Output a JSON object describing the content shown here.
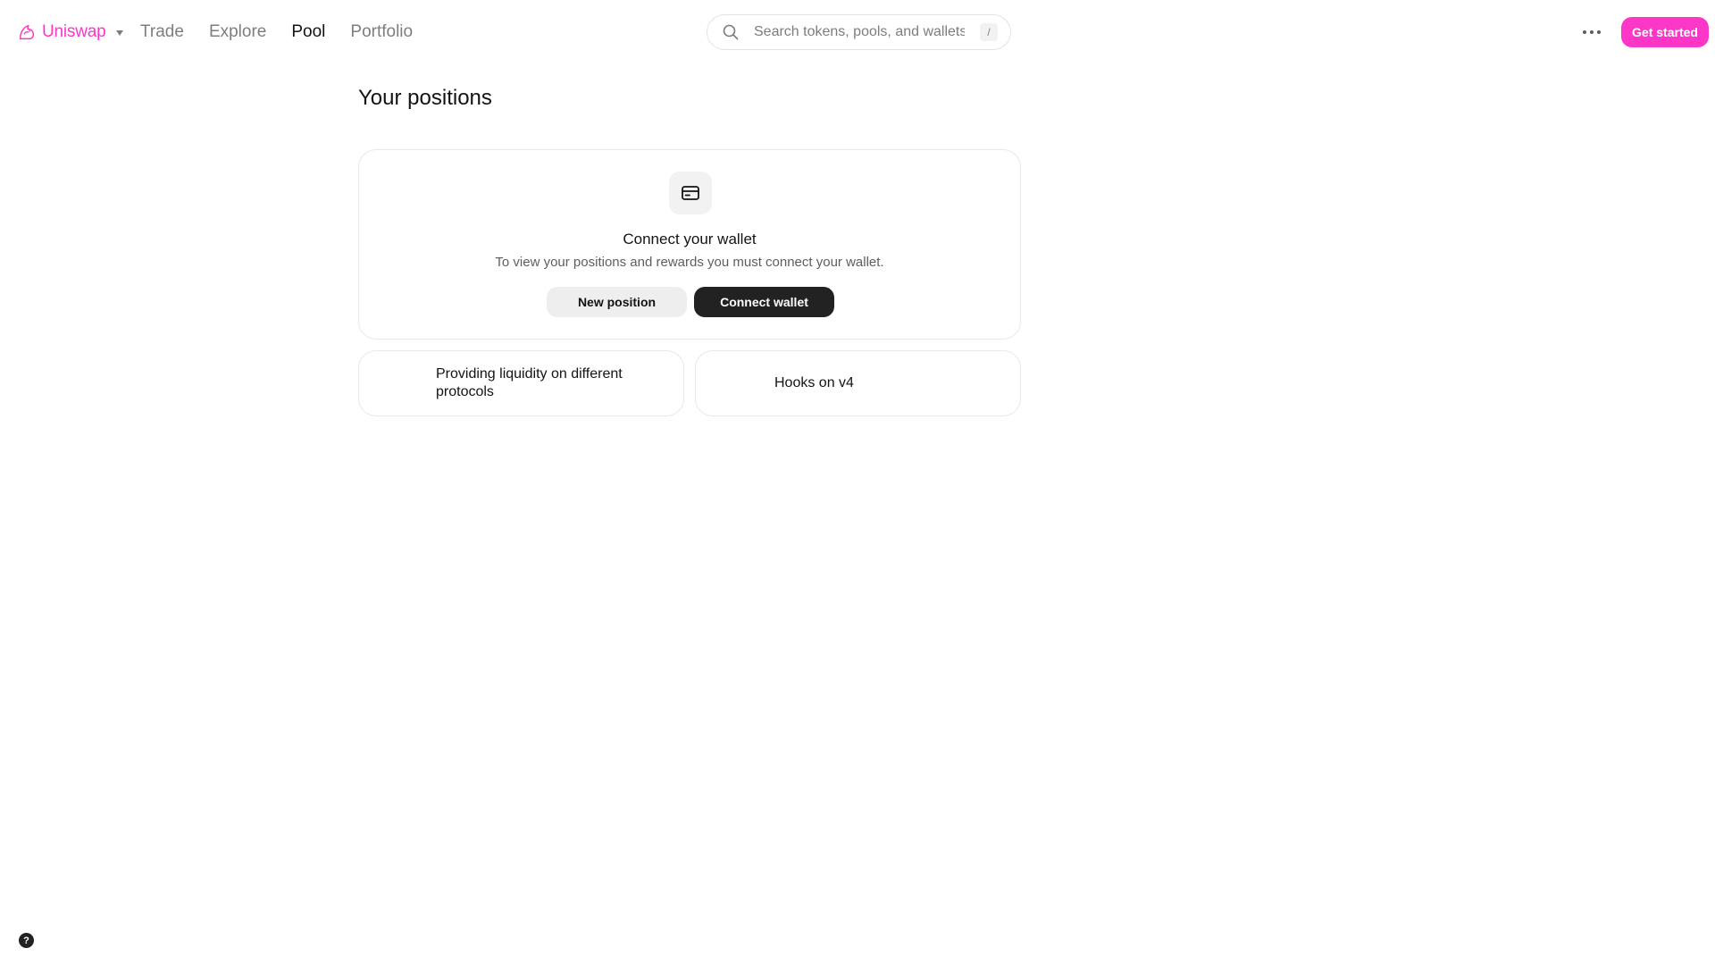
{
  "colors": {
    "brand_pink": "#fc37c8",
    "text_primary": "#131313",
    "text_secondary": "#7d7d7d",
    "dark_button": "#222222"
  },
  "header": {
    "brand": {
      "name": "Uniswap",
      "icon": "uniswap-unicorn-icon"
    },
    "nav": {
      "trade": "Trade",
      "explore": "Explore",
      "pool": "Pool",
      "portfolio": "Portfolio"
    },
    "active_nav": "Pool",
    "search": {
      "placeholder": "Search tokens, pools, and wallets",
      "value": "",
      "shortcut": "/"
    },
    "more_icon": "ellipsis-icon",
    "get_started": "Get started"
  },
  "main": {
    "title": "Your positions",
    "wallet_card": {
      "icon": "wallet-icon",
      "title": "Connect your wallet",
      "description": "To view your positions and rewards you must connect your wallet.",
      "new_position": "New position",
      "connect_wallet": "Connect wallet"
    },
    "info_cards": {
      "liquidity": "Providing liquidity on different protocols",
      "hooks": "Hooks on v4"
    }
  },
  "footer": {
    "help": "?"
  }
}
